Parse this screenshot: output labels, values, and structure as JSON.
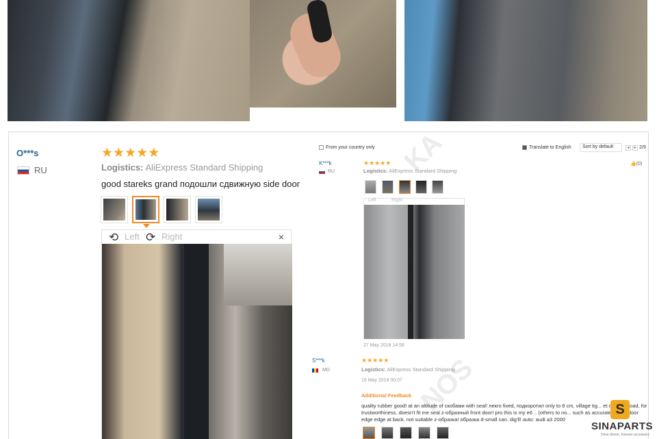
{
  "photos": [
    {
      "icon": "van-step-seal-photo"
    },
    {
      "icon": "rubber-seal-in-hand-photo"
    },
    {
      "icon": "door-seal-installed-photo"
    }
  ],
  "review": {
    "username": "O***s",
    "country": "RU",
    "stars": "★★★★★",
    "logistics_label": "Logistics:",
    "logistics_value": "AliExpress Standard Shipping",
    "feedback": "good stareks grand подошли сдвижную side door",
    "viewer": {
      "left_label": "Left",
      "right_label": "Right",
      "close": "×",
      "rotate_left_icon": "⟲",
      "rotate_right_icon": "⟳"
    }
  },
  "embedded": {
    "from_country": "From your country only",
    "translate": "Translate to English",
    "sort": "Sort by default",
    "page": "2/9",
    "likes": "(0)",
    "review1": {
      "username": "K***k",
      "country": "RU",
      "stars": "★★★★★",
      "logistics_label": "Logistics:",
      "logistics_value": "AliExpress Standard Shipping",
      "date": "27 May 2018 14:56",
      "left_label": "Left",
      "right_label": "Right"
    },
    "review2": {
      "username": "S***k",
      "country": "MD",
      "stars": "★★★★★",
      "logistics_label": "Logistics:",
      "logistics_value": "AliExpress Standard Shipping",
      "date": "16 May 2018 00:07",
      "additional_label": "Additional Feedback",
      "additional_text": "quality rubber good! at an altitude of скобами with seal! лекго fixed, подкоротил only to 8 cm, village tig... et can i preload, for trustworthiness. doesn't fit me seal z-образный front door! pro this is my e6 .. (others to no... such as accurately front door edge edge at back. not suitable z-образка! образка d-small can. dig'll! auto: audi a3 2000"
    }
  },
  "brand": {
    "logo_letter": "S",
    "name": "SINAPARTS",
    "tagline": "Drive driven. Forever accessory"
  }
}
